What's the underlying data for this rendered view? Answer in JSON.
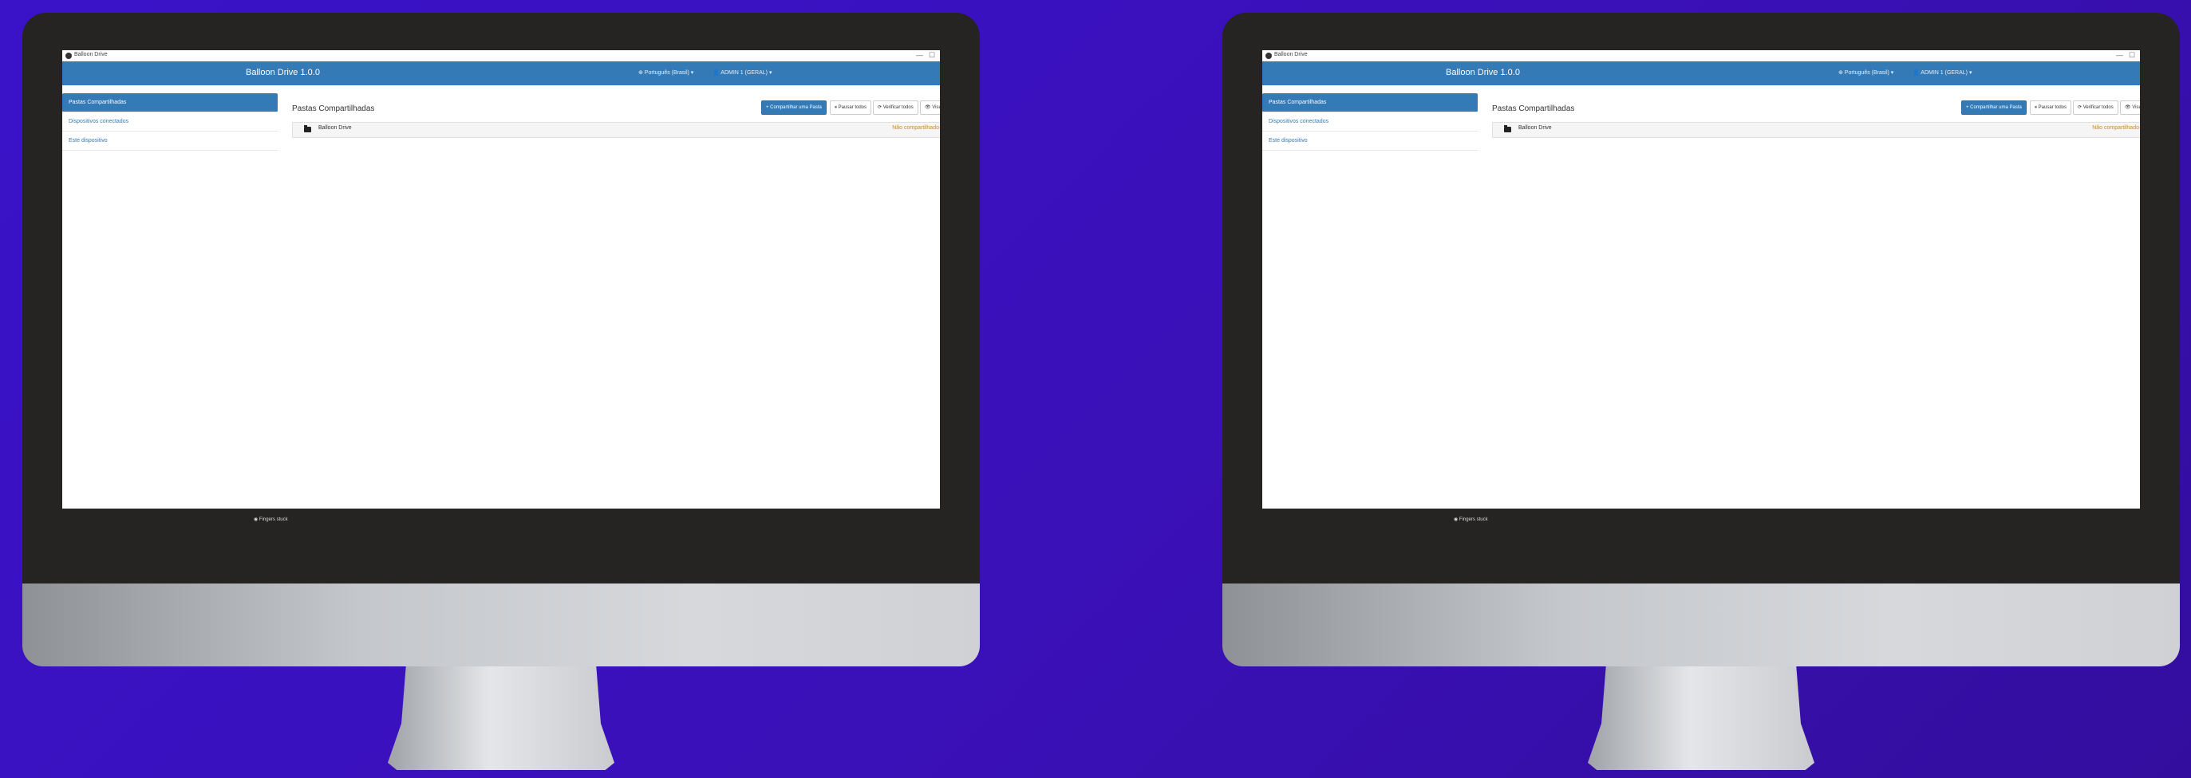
{
  "window": {
    "title": "Balloon Drive",
    "controls": [
      "—",
      "☐"
    ]
  },
  "navbar": {
    "brand": "Balloon Drive 1.0.0",
    "language": "⊕ Português (Brasil) ▾",
    "user": "👤 ADMIN 1 (GERAL) ▾"
  },
  "sidebar": {
    "items": [
      {
        "label": "Pastas Compartilhadas",
        "active": true
      },
      {
        "label": "Dispositivos conectados",
        "active": false
      },
      {
        "label": "Este dispositivo",
        "active": false
      }
    ]
  },
  "main": {
    "title": "Pastas Compartilhadas",
    "buttons": {
      "add": "+ Compartilhar uma Pasta",
      "pause": "⏸ Pausar todos",
      "rescan": "⟳ Verificar todos",
      "view": "👁 Visualizar"
    },
    "drive": {
      "name": "Balloon Drive",
      "status": "Não compartilhado"
    }
  },
  "footer": {
    "status": "◉ Fingers stuck"
  },
  "colors": {
    "background": "#3a13c9",
    "navbar": "#337ab7",
    "bezel": "#262323"
  }
}
